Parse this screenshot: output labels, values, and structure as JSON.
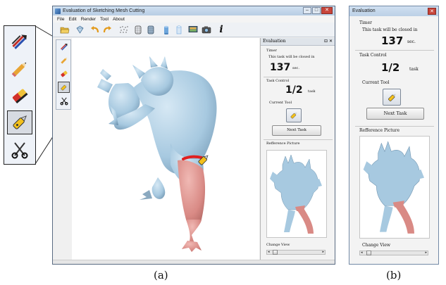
{
  "window": {
    "title": "Evaluation of Sketching Mesh Cutting",
    "minimize": "‒",
    "maximize": "□",
    "close": "✕"
  },
  "menu": [
    "File",
    "Edit",
    "Render",
    "Tool",
    "About"
  ],
  "toolbar": {
    "info_label": "i",
    "icons": [
      "open-folder-icon",
      "diamond-icon",
      "undo-icon",
      "redo-icon",
      "scatter-points-icon",
      "wireframe-model-icon",
      "shaded-model-icon",
      "cylinder-blue-icon",
      "cylinder-outline-icon",
      "screen-capture-icon",
      "camera-icon",
      "info-icon"
    ]
  },
  "tools": [
    "multi-pen-icon",
    "pencil-icon",
    "eraser-icon",
    "cutter-knife-icon",
    "scissors-icon"
  ],
  "selected_tool": "cutter-knife-icon",
  "panel": {
    "title": "Evaluation",
    "dock_buttons": "⊡ ✕",
    "timer_label": "Timer",
    "timer_text": "This task will be closed in",
    "timer_value": "137",
    "timer_unit": "sec.",
    "task_control_label": "Task Control",
    "task_progress": "1/2",
    "task_unit": "task",
    "current_tool_label": "Current Tool",
    "next_button": "Next Task",
    "reference_label": "Refference Picture",
    "change_view_label": "Change View",
    "slider_left": "◂",
    "slider_right": "▸"
  },
  "captions": {
    "a": "(a)",
    "b": "(b)"
  },
  "colors": {
    "model_blue": "#a7c9e0",
    "model_red": "#d98a85",
    "cut_stroke": "#e02020",
    "titlebar": "#c3d6ec",
    "close_button": "#c8453b"
  }
}
